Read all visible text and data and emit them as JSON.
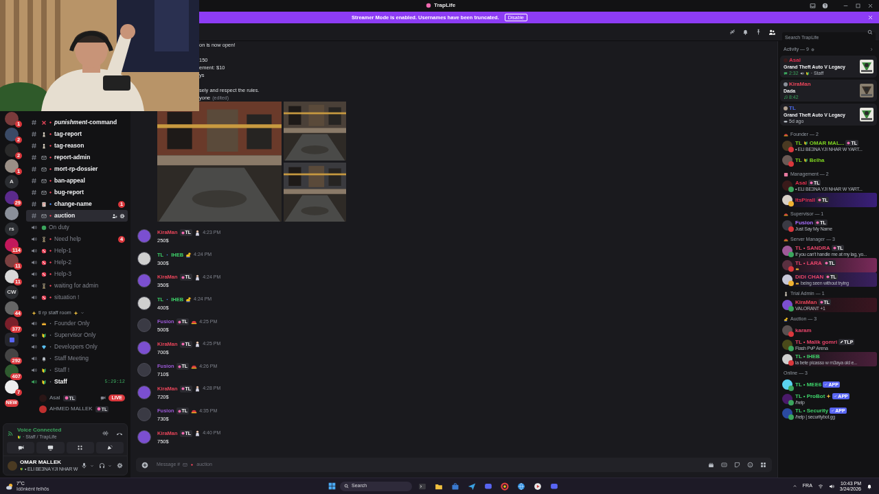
{
  "window": {
    "title": "TrapLife"
  },
  "banner": {
    "text": "Streamer Mode is enabled. Usernames have been truncated.",
    "button": "Disable"
  },
  "servers": [
    {
      "kind": "picture",
      "color": "#7a3b3b",
      "badge": "1"
    },
    {
      "kind": "picture",
      "color": "#3a4a66",
      "badge": "2"
    },
    {
      "kind": "picture",
      "color": "#2a2a2a",
      "badge": "2"
    },
    {
      "kind": "picture",
      "color": "#9a8f86",
      "badge": "1"
    },
    {
      "kind": "letter",
      "text": "A"
    },
    {
      "kind": "picture",
      "color": "#5b2a8c",
      "badge": "29"
    },
    {
      "kind": "picture",
      "color": "#8a8f99"
    },
    {
      "kind": "letter",
      "text": "rs"
    },
    {
      "kind": "picture",
      "color": "#c2185b",
      "badge": "114"
    },
    {
      "kind": "picture",
      "color": "#7a4040",
      "badge": "11"
    },
    {
      "kind": "picture",
      "color": "#d8d8d8",
      "badge": "11"
    },
    {
      "kind": "letter",
      "text": "CW"
    },
    {
      "kind": "picture",
      "color": "#666666",
      "badge": "44"
    },
    {
      "kind": "picture",
      "color": "#7a1f2a",
      "badge": "377"
    },
    {
      "kind": "folder",
      "color": "#5865f2"
    },
    {
      "kind": "picture",
      "color": "#444444",
      "badge": "292"
    },
    {
      "kind": "picture",
      "color": "#2f5a2f",
      "badge": "407"
    },
    {
      "kind": "picture",
      "color": "#eeeeee",
      "badge": "7"
    },
    {
      "kind": "new",
      "text": "NEW"
    }
  ],
  "channels": [
    {
      "kind": "text",
      "name": "*punishment*-command",
      "selected": false,
      "connected": false
    },
    {
      "kind": "text",
      "name": "tag-report",
      "selected": false,
      "connected": false
    },
    {
      "kind": "text",
      "name": "tag-reason",
      "selected": false,
      "connected": false
    },
    {
      "kind": "text",
      "name": "report-admin",
      "selected": false,
      "connected": false
    },
    {
      "kind": "text",
      "name": "mort-rp-dossier",
      "selected": false,
      "connected": false
    },
    {
      "kind": "text",
      "name": "ban-appeal",
      "selected": false,
      "connected": false
    },
    {
      "kind": "text",
      "name": "bug-report",
      "selected": false,
      "connected": false
    },
    {
      "kind": "text",
      "name": "change-name",
      "badge": "1",
      "selected": false,
      "connected": false
    },
    {
      "kind": "text",
      "name": "auction",
      "selected": true,
      "connected": false
    },
    {
      "kind": "voice",
      "name": "On duty",
      "selected": false,
      "connected": false
    },
    {
      "kind": "voice",
      "name": "Need help",
      "badge": "4",
      "selected": false,
      "connected": false
    },
    {
      "kind": "voice",
      "name": "Help-1",
      "selected": false,
      "connected": false
    },
    {
      "kind": "voice",
      "name": "Help-2",
      "selected": false,
      "connected": false
    },
    {
      "kind": "voice",
      "name": "Help-3",
      "selected": false,
      "connected": false
    },
    {
      "kind": "voice",
      "name": "waiting for admin",
      "selected": false,
      "connected": false
    },
    {
      "kind": "voice",
      "name": "situation !",
      "selected": false,
      "connected": false
    }
  ],
  "category": {
    "name": "tl rp staff room"
  },
  "staff_channels": [
    {
      "kind": "voice",
      "name": "Founder Only",
      "selected": false,
      "connected": false
    },
    {
      "kind": "voice",
      "name": "Supervisor Only",
      "selected": false,
      "connected": false
    },
    {
      "kind": "voice",
      "name": "Developers Only",
      "selected": false,
      "connected": false
    },
    {
      "kind": "voice",
      "name": "Staff Meeting",
      "selected": false,
      "connected": false
    },
    {
      "kind": "voice",
      "name": "Staff !",
      "selected": false,
      "connected": false
    },
    {
      "kind": "voice",
      "name": "Staff",
      "timer": "5:29:12",
      "selected": false,
      "connected": true
    }
  ],
  "voice_users": [
    {
      "name": "Asal",
      "tag": "TL",
      "badge": "LIVE"
    },
    {
      "name": "AHMED MALLEK",
      "tag": "TL"
    }
  ],
  "voice_panel": {
    "status": "Voice Connected",
    "channel": "· Staff / TrapLife"
  },
  "user": {
    "name": "OMAR MALLEK",
    "status": "• ELI BE3NA YJI NHAR W"
  },
  "header": {
    "placeholder": "Search TrapLife"
  },
  "announcement": {
    "paragraphs": [
      [
        "on is now open!"
      ],
      [
        "150",
        "ement: $10",
        "ys"
      ],
      [
        "sely and respect the rules.",
        "yone"
      ]
    ],
    "edited": "(edited)"
  },
  "attachments": [
    {
      "kind": "picture"
    },
    {
      "kind": "picture"
    },
    {
      "kind": "picture"
    }
  ],
  "messages": [
    {
      "author": "KiraMan",
      "color": "#e8455a",
      "tag": "TL",
      "time": "4:23 PM",
      "text": "250$"
    },
    {
      "prefix": "TL",
      "author": "IHEB",
      "color": "#3ed36a",
      "time": "4:24 PM",
      "text": "300$"
    },
    {
      "author": "KiraMan",
      "color": "#e8455a",
      "tag": "TL",
      "time": "4:24 PM",
      "text": "350$"
    },
    {
      "prefix": "TL",
      "author": "IHEB",
      "color": "#3ed36a",
      "time": "4:24 PM",
      "text": "400$"
    },
    {
      "author": "Fusion",
      "color": "#9b59d6",
      "tag": "TL",
      "time": "4:25 PM",
      "text": "500$"
    },
    {
      "author": "KiraMan",
      "color": "#e8455a",
      "tag": "TL",
      "time": "4:25 PM",
      "text": "700$"
    },
    {
      "author": "Fusion",
      "color": "#9b59d6",
      "tag": "TL",
      "time": "4:26 PM",
      "text": "710$"
    },
    {
      "author": "KiraMan",
      "color": "#e8455a",
      "tag": "TL",
      "time": "4:28 PM",
      "text": "720$"
    },
    {
      "author": "Fusion",
      "color": "#9b59d6",
      "tag": "TL",
      "time": "4:35 PM",
      "text": "730$"
    },
    {
      "author": "KiraMan",
      "color": "#e8455a",
      "tag": "TL",
      "time": "4:40 PM",
      "text": "750$"
    }
  ],
  "composer": {
    "prefix": "Message #",
    "channel": "auction"
  },
  "activity": {
    "title": "Activity — 9",
    "cards": [
      {
        "user": "Asal",
        "color": "#e0304f",
        "title": "Grand Theft Auto V Legacy",
        "kind": "voice",
        "detail": "2:32",
        "extra": "· Staff"
      },
      {
        "user": "KiraMan",
        "color": "#e8455a",
        "title": "Dada",
        "kind": "music",
        "detail": "8:42"
      },
      {
        "user": "TL",
        "color": "#4a6cf0",
        "title": "Grand Theft Auto V Legacy",
        "kind": "played",
        "detail": "5d ago"
      }
    ]
  },
  "groups": [
    {
      "title": "Founder — 2",
      "members": [
        {
          "prefix": "TL",
          "name": "OMAR MAL...",
          "color": "#7ed321",
          "tag": {
            "text": "TL",
            "kind": "role"
          },
          "sub": "• ELI BE3NA YJI NHAR W YART...",
          "status": {
            "color": "#da373c"
          }
        },
        {
          "prefix": "TL",
          "name": "Belha",
          "color": "#7ed321",
          "status": {
            "color": "#da373c"
          }
        }
      ]
    },
    {
      "title": "Management — 2",
      "members": [
        {
          "name": "Asal",
          "color": "#e0304f",
          "tag": {
            "text": "TL",
            "kind": "role"
          },
          "sub": "• ELI BE3NA YJI NHAR W YART...",
          "status": {
            "color": "#3ba55d"
          }
        },
        {
          "name": "ItsPirall",
          "color": "#e0304f",
          "tag": {
            "text": "TL",
            "kind": "role"
          },
          "status": {
            "color": "#f0b232"
          }
        }
      ]
    },
    {
      "title": "Supervisor — 1",
      "members": [
        {
          "name": "Fusion",
          "color": "#a970ff",
          "tag": {
            "text": "TL",
            "kind": "role"
          },
          "sub": "Just Say My Name",
          "status": {
            "color": "#da373c"
          }
        }
      ]
    },
    {
      "title": "Server Manager — 3",
      "members": [
        {
          "prefix": "TL •",
          "name": "SANDRA",
          "color": "#e8456a",
          "tag": {
            "text": "TL",
            "kind": "role"
          },
          "sub": "If you can't handle me at my lag, yo...",
          "status": {
            "color": "#3ba55d"
          }
        },
        {
          "prefix": "TL •",
          "name": "LARA",
          "color": "#e8456a",
          "tag": {
            "text": "TL",
            "kind": "role"
          },
          "status": {
            "color": "#da373c"
          }
        },
        {
          "name": "DiDi CHAN",
          "color": "#e8456a",
          "tag": {
            "text": "TL",
            "kind": "role"
          },
          "sub": "being seen without trying",
          "status": {
            "color": "#f0b232"
          }
        }
      ]
    },
    {
      "title": "Trial Admin — 1",
      "members": [
        {
          "name": "KiraMan",
          "color": "#e8455a",
          "tag": {
            "text": "TL",
            "kind": "role"
          },
          "sub": "VALORANT +1",
          "status": {
            "color": "#3ba55d"
          }
        }
      ]
    },
    {
      "title": "Auction — 3",
      "members": [
        {
          "name": "karam",
          "color": "#e8456a",
          "status": {
            "color": "#da373c"
          }
        },
        {
          "prefix": "TL •",
          "name": "Malik gomri",
          "color": "#e8456a",
          "tag": {
            "text": "TLP",
            "kind": "pen"
          },
          "sub": "Flash PvP Arena",
          "status": {
            "color": "#3ba55d"
          }
        },
        {
          "prefix": "TL •",
          "name": "IHEB",
          "color": "#3ed36a",
          "sub": "la bete picasso w m3aya old e...",
          "status": {
            "color": "#da373c"
          }
        }
      ]
    },
    {
      "title": "Online — 3",
      "members": [
        {
          "prefix": "TL •",
          "name": "MEE6",
          "color": "#3ed36a",
          "tag": {
            "text": "APP",
            "kind": "app"
          },
          "status": {
            "color": "#3ba55d"
          }
        },
        {
          "prefix": "TL •",
          "name": "ProBot",
          "color": "#3ed36a",
          "tag": {
            "text": "APP",
            "kind": "app"
          },
          "sub": "/help",
          "status": {
            "color": "#3ba55d"
          }
        },
        {
          "prefix": "TL •",
          "name": "Security",
          "color": "#3ed36a",
          "tag": {
            "text": "APP",
            "kind": "app"
          },
          "sub": "/help | securitybot.gg",
          "status": {
            "color": "#3ba55d"
          }
        }
      ]
    }
  ],
  "taskbar": {
    "temp": "7°C",
    "weather": "Időnként felhős",
    "search": "Search",
    "lang": "FRA",
    "time": "10:43 PM",
    "date": "3/24/2026"
  }
}
